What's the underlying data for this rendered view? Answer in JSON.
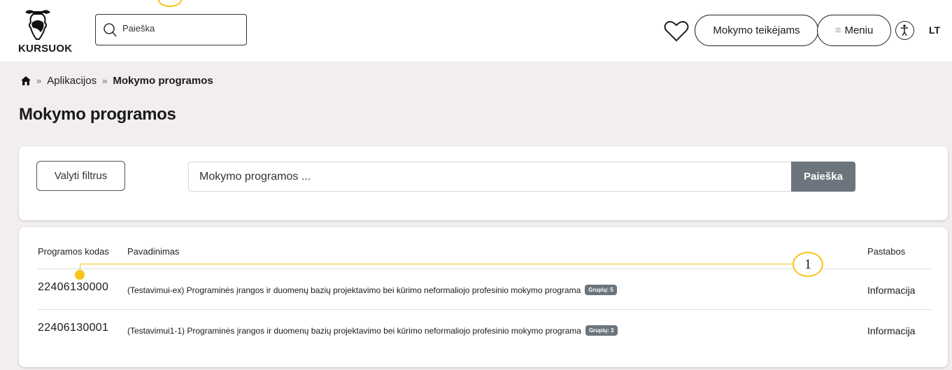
{
  "header": {
    "logo_text": "KURSUOK",
    "search_placeholder": "Paieška",
    "provider_button": "Mokymo teikėjams",
    "menu_icon": "≡",
    "menu_button": "Meniu",
    "language": "LT"
  },
  "breadcrumb": {
    "home_icon": "home-icon",
    "separator": "»",
    "items": [
      "Aplikacijos",
      "Mokymo programos"
    ]
  },
  "page_title": "Mokymo programos",
  "filters": {
    "clear_button": "Valyti filtrus",
    "search_placeholder": "Mokymo programos ...",
    "search_button": "Paieška"
  },
  "table": {
    "headers": {
      "code": "Programos kodas",
      "name": "Pavadinimas",
      "notes": "Pastabos"
    },
    "rows": [
      {
        "code": "22406130000",
        "name": "(Testavimui-ex) Programinės įrangos ir duomenų bazių projektavimo bei kūrimo neformaliojo profesinio mokymo programa",
        "badge": "Grupių: 5",
        "notes": "Informacija"
      },
      {
        "code": "22406130001",
        "name": "(Testavimui1-1) Programinės įrangos ir duomenų bazių projektavimo bei kūrimo neformaliojo profesinio mokymo programa",
        "badge": "Grupių: 3",
        "notes": "Informacija"
      }
    ]
  },
  "annotation": {
    "number": "1",
    "color": "#f5c518"
  },
  "colors": {
    "page_bg": "#f3eeee",
    "button_gray": "#6c757d",
    "annotation": "#f5c518"
  }
}
